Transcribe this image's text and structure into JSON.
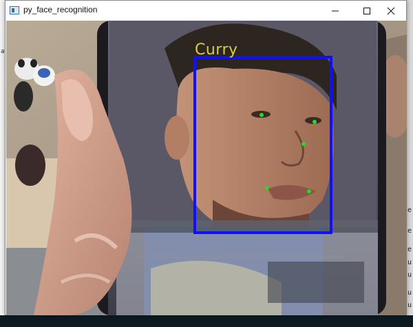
{
  "window": {
    "title": "py_face_recognition",
    "controls": [
      "minimize-icon",
      "maximize-icon",
      "close-icon"
    ]
  },
  "detection": {
    "label": "Curry",
    "box_color": "#1010ff",
    "label_color": "#d8cf3c",
    "landmark_color": "#22dd22",
    "landmark_count": 5
  },
  "background": {
    "right_edge_chars": [
      "e",
      "e",
      "e",
      "u",
      "u",
      "u",
      "u"
    ],
    "left_edge_chars": [
      "a"
    ]
  }
}
